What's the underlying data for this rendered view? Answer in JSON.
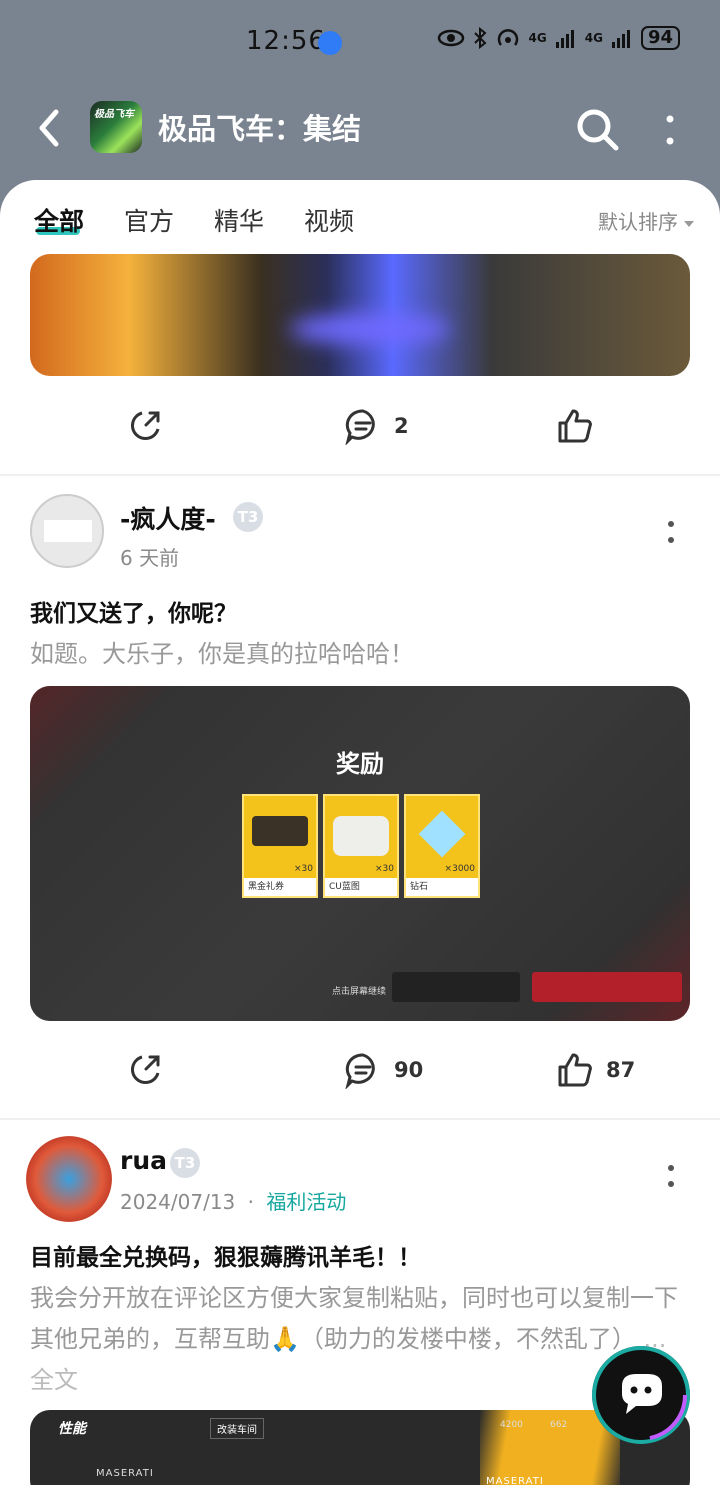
{
  "status_bar": {
    "time": "12:56",
    "network_1": "4G",
    "network_2": "4G",
    "battery": "94"
  },
  "header": {
    "app_title": "极品飞车：集结",
    "logo_text": "极品飞车"
  },
  "tabs": [
    {
      "label": "全部",
      "active": true
    },
    {
      "label": "官方",
      "active": false
    },
    {
      "label": "精华",
      "active": false
    },
    {
      "label": "视频",
      "active": false
    }
  ],
  "sort": {
    "label": "默认排序"
  },
  "posts": [
    {
      "actions": {
        "comment_count": "2",
        "like_count": ""
      }
    },
    {
      "author": "-疯人度-",
      "level": "T3",
      "time": "6 天前",
      "title": "我们又送了，你呢？",
      "body": "如题。大乐子，你是真的拉哈哈哈！",
      "image": {
        "heading": "奖励",
        "items": [
          {
            "label": "黑金礼券",
            "qty": "×30"
          },
          {
            "label": "CU蓝图",
            "qty": "×30"
          },
          {
            "label": "钻石",
            "qty": "×3000"
          }
        ],
        "hint": "点击屏幕继续"
      },
      "actions": {
        "comment_count": "90",
        "like_count": "87"
      }
    },
    {
      "author": "rua",
      "level": "T3",
      "time": "2024/07/13",
      "category": "福利活动",
      "title": "目前最全兑换码，狠狠薅腾讯羊毛！！",
      "body": "我会分开放在评论区方便大家复制粘贴，同时也可以复制一下其他兄弟的，互帮互助🙏（助力的发楼中楼，不然乱了）",
      "fulltext_label": "... 全文",
      "image": {
        "tag": "性能",
        "tab": "改装车间",
        "brand": "MASERATI",
        "stat_1": "4200",
        "stat_2": "662"
      }
    }
  ],
  "colors": {
    "accent": "#16a89f",
    "header_bg": "#7a8390"
  }
}
